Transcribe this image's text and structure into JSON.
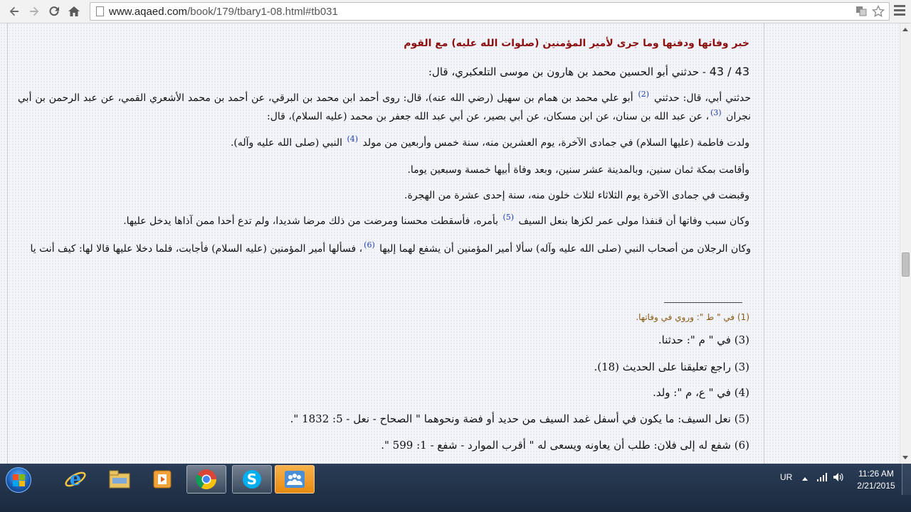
{
  "browser": {
    "url_host": "www.aqaed.com",
    "url_path": "/book/179/tbary1-08.html#tb031",
    "back_icon": "back-arrow-icon",
    "forward_icon": "forward-arrow-icon",
    "reload_icon": "reload-icon",
    "home_icon": "home-icon"
  },
  "article": {
    "title": "خبر وفاتها ودفنها وما جرى لأمير المؤمنين (صلوات الله عليه) مع القوم",
    "narration_number": "43 / 43",
    "lead": "- حدثني أبو الحسين محمد بن هارون بن موسى التلعكبري، قال:",
    "p1_a": "حدثني أبي، قال: حدثني ",
    "p1_ref1": "(2)",
    "p1_b": " أبو علي محمد بن همام بن سهيل (رضي الله عنه)، قال: روى أحمد ابن محمد بن البرقي، عن أحمد بن محمد الأشعري القمي، عن عبد الرحمن بن أبي نجران ",
    "p1_ref2": "(3)",
    "p1_c": "، عن عبد الله بن سنان، عن ابن مسكان، عن أبي بصير، عن أبي عبد الله جعفر بن محمد (عليه السلام)، قال:",
    "p2_a": "ولدت فاطمة (عليها السلام) في جمادى الآخرة، يوم العشرين منه، سنة خمس وأربعين من مولد ",
    "p2_ref": "(4)",
    "p2_b": " النبي (صلى الله عليه وآله).",
    "p3": "وأقامت بمكة ثمان سنين، وبالمدينة عشر سنين، وبعد وفاة أبيها خمسة وسبعين يوما.",
    "p4": "وقبضت في جمادى الآخرة يوم الثلاثاء لثلاث خلون منه، سنة إحدى عشرة من الهجرة.",
    "p5_a": "وكان سبب وفاتها أن قنفذا مولى عمر لكزها بنعل السيف ",
    "p5_ref": "(5)",
    "p5_b": " بأمره، فأسقطت محسنا ومرضت من ذلك مرضا شديدا، ولم تدع أحدا ممن آذاها يدخل عليها.",
    "p6_a": "وكان الرجلان من أصحاب النبي (صلى الله عليه وآله) سألا أمير المؤمنين أن يشفع لهما إليها ",
    "p6_ref": "(6)",
    "p6_b": "، فسألها أمير المؤمنين (عليه السلام) فأجابت، فلما دخلا عليها قالا لها: كيف أنت يا"
  },
  "footnotes": {
    "fn1": "(1) في \" ط \": وروي في وفاتها.",
    "fn3a": "(3) في \" م \": حدثنا.",
    "fn3b": "(3) راجع تعليقنا على الحديث (18).",
    "fn4": "(4) في \" ع، م \": ولد.",
    "fn5": "(5) نعل السيف: ما يكون في أسفل غمد السيف من حديد أو فضة ونحوهما \" الصحاح - نعل - 5: 1832 \".",
    "fn6": "(6) شفع له إلى فلان: طلب أن يعاونه ويسعى له \" أقرب الموارد - شفع - 1: 599 \"."
  },
  "taskbar": {
    "apps": [
      "windows-start-icon",
      "internet-explorer-icon",
      "file-explorer-icon",
      "media-player-icon",
      "chrome-icon",
      "skype-icon",
      "users-app-icon"
    ],
    "active_app": "chrome-icon",
    "lang": "UR",
    "time": "11:26 AM",
    "date": "2/21/2015"
  }
}
